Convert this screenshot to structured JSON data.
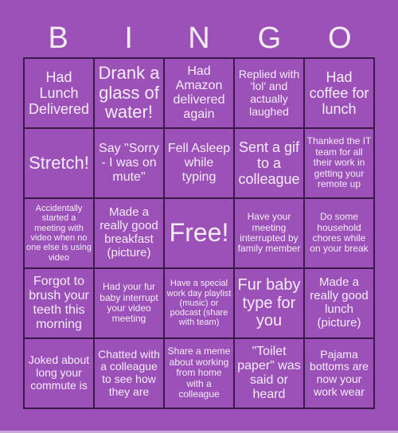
{
  "header": [
    "B",
    "I",
    "N",
    "G",
    "O"
  ],
  "cells": [
    "Had Lunch Delivered",
    "Drank a glass of water!",
    "Had Amazon delivered again",
    "Replied with 'lol' and actually laughed",
    "Had coffee for lunch",
    "Stretch!",
    "Say \"Sorry - I was on mute\"",
    "Fell Asleep while typing",
    "Sent a gif to a colleague",
    "Thanked the IT team for all their work in getting your remote up",
    "Accidentally started a meeting with video when no one else is using video",
    "Made a really good breakfast (picture)",
    "Free!",
    "Have your meeting interrupted by family member",
    "Do some household chores while on your break",
    "Forgot to brush your teeth this morning",
    "Had your fur baby interrupt your video meeting",
    "Have a special work day playlist (music) or podcast (share with team)",
    "Fur baby type for you",
    "Made a really good lunch (picture)",
    "Joked about long your commute is",
    "Chatted with a colleague to see how they are",
    "Share a meme about working from home with a colleague",
    "\"Toilet paper\" was said or heard",
    "Pajama bottoms are now your work wear"
  ],
  "colors": {
    "background": "#9c51b9",
    "grid_line": "#3a1a4a",
    "text": "#f4ecf8"
  }
}
